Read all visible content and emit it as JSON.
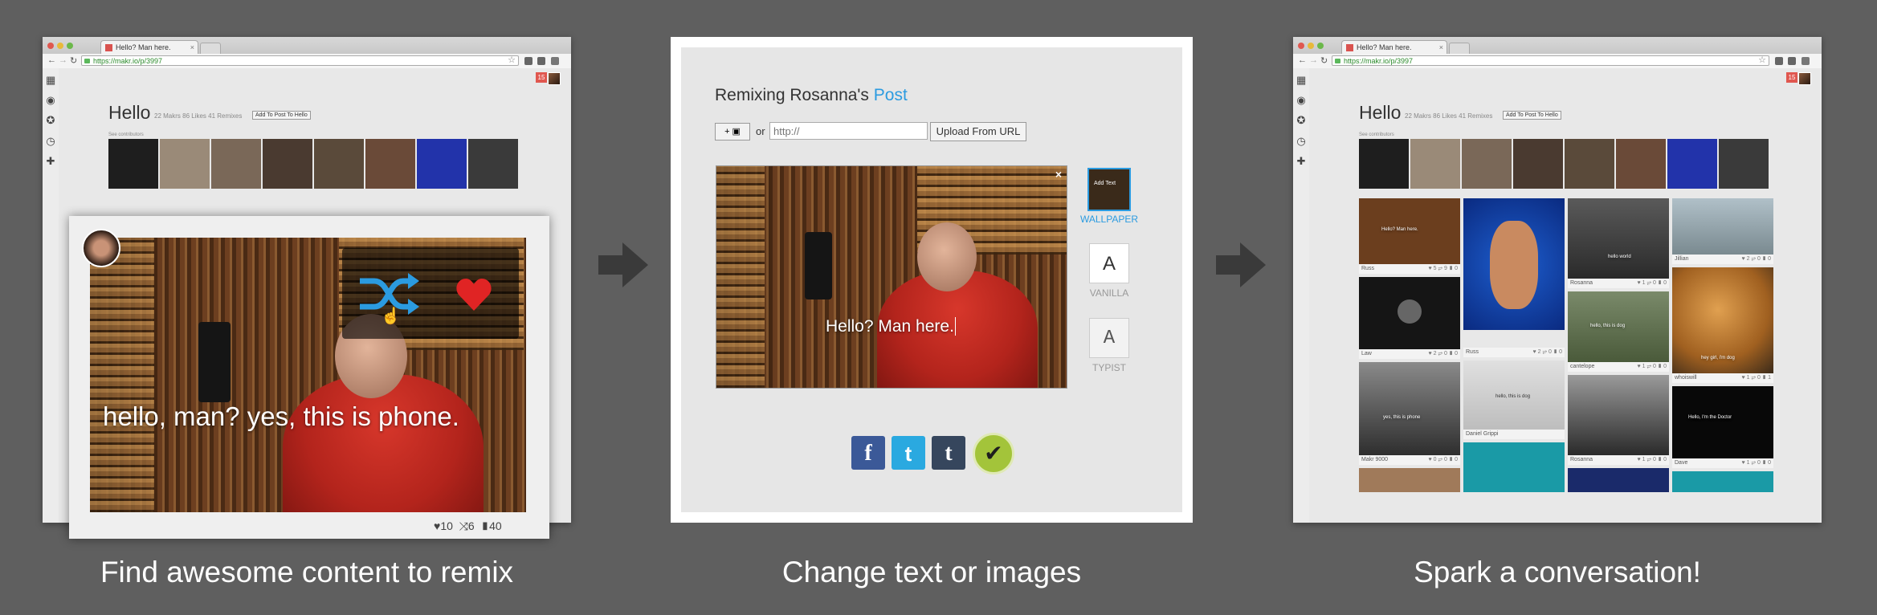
{
  "panel1": {
    "browser": {
      "tab_title": "Hello? Man here.",
      "url": "https://makr.io/p/3997",
      "notif_count": "15"
    },
    "page": {
      "title": "Hello",
      "stats": "22 Makrs 86 Likes 41 Remixes",
      "add_button": "Add To Post To Hello",
      "see_contributors": "See contributors"
    },
    "card": {
      "caption": "hello, man?  yes, this is phone.",
      "likes": "10",
      "remixes": "6",
      "comments": "40"
    },
    "label": "Find awesome content to remix"
  },
  "panel2": {
    "heading_prefix": "Remixing Rosanna's ",
    "heading_link": "Post",
    "camera_button": "+ ▣",
    "or_text": "or",
    "url_placeholder": "http://",
    "upload_button": "Upload From URL",
    "caption": "Hello? Man here.",
    "close": "×",
    "styles": [
      {
        "name": "WALLPAPER",
        "sample": "Add Text"
      },
      {
        "name": "VANILLA",
        "sample": "A"
      },
      {
        "name": "TYPIST",
        "sample": "A"
      }
    ],
    "share": {
      "facebook": "f",
      "twitter": "t",
      "tumblr": "t",
      "done": "✔"
    },
    "label": "Change text or images"
  },
  "panel3": {
    "browser": {
      "tab_title": "Hello? Man here.",
      "url": "https://makr.io/p/3997",
      "notif_count": "15"
    },
    "page": {
      "title": "Hello",
      "stats": "22 Makrs 86 Likes 41 Remixes",
      "add_button": "Add To Post To Hello",
      "see_contributors": "See contributors"
    },
    "tiles": [
      {
        "name": "Russ",
        "counts": "♥ 5 ⥂ 9 ▮ 0",
        "caption": "Hello? Man here."
      },
      {
        "name": "Russ",
        "counts": "♥ 2 ⥂ 0 ▮ 0",
        "caption": ""
      },
      {
        "name": "Rosanna",
        "counts": "♥ 1 ⥂ 0 ▮ 0",
        "caption": "hello world"
      },
      {
        "name": "Jillian",
        "counts": "♥ 2 ⥂ 0 ▮ 0",
        "caption": ""
      },
      {
        "name": "Law",
        "counts": "♥ 2 ⥂ 0 ▮ 0",
        "caption": ""
      },
      {
        "name": "Daniel Grippi",
        "counts": "",
        "caption": "hello, this is dog"
      },
      {
        "name": "cantelope",
        "counts": "♥ 1 ⥂ 0 ▮ 0",
        "caption": "hello, this is dog"
      },
      {
        "name": "whoiswill",
        "counts": "♥ 1 ⥂ 0 ▮ 1",
        "caption": "hey girl, i'm dog"
      },
      {
        "name": "Makr 9000",
        "counts": "♥ 0 ⥂ 0 ▮ 0",
        "caption": "yes, this is phone"
      },
      {
        "name": "Rosanna",
        "counts": "♥ 1 ⥂ 0 ▮ 0",
        "caption": ""
      },
      {
        "name": "Dave",
        "counts": "♥ 1 ⥂ 0 ▮ 0",
        "caption": "Hello, I'm the Doctor"
      }
    ],
    "label": "Spark a conversation!"
  },
  "colors": {
    "background": "#5f5f5f",
    "accent_blue": "#2b9be0",
    "heart": "#e02424",
    "done_green": "#a3c43a"
  }
}
